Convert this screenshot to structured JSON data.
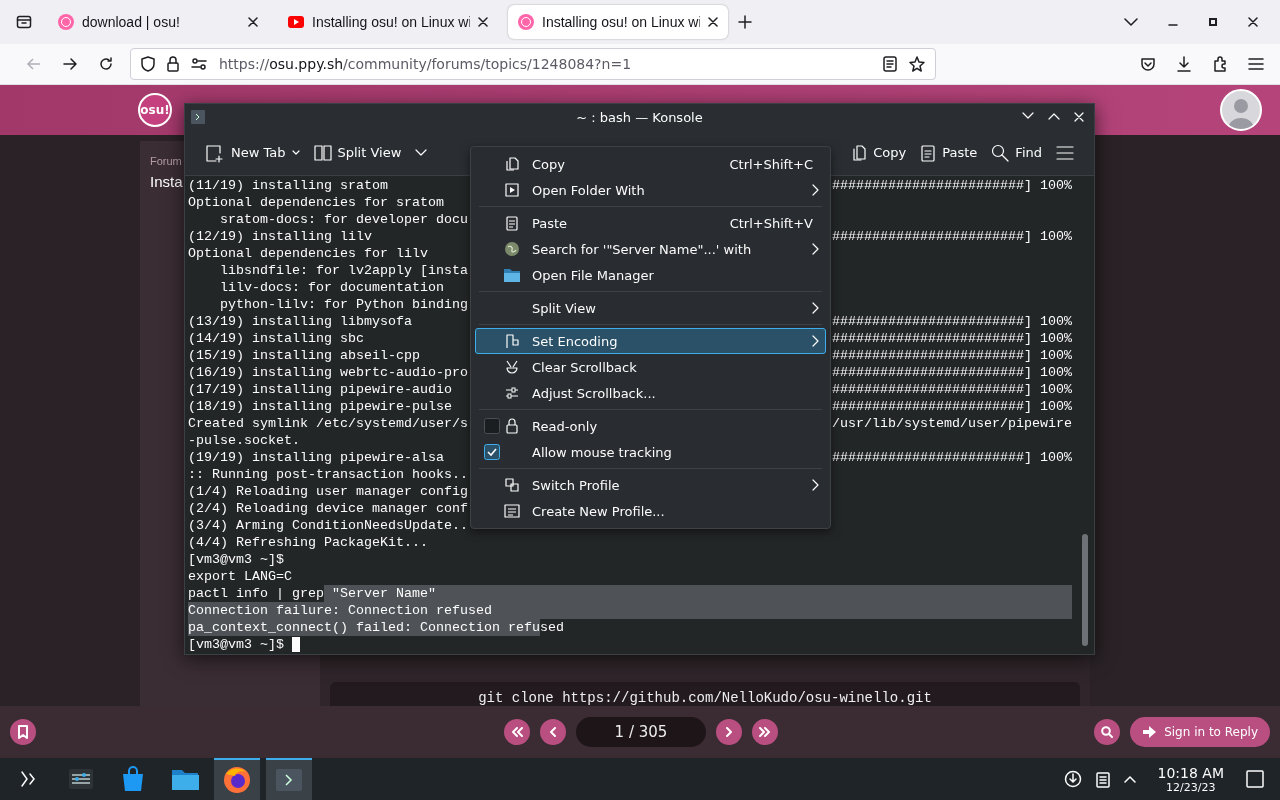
{
  "browser": {
    "tabs": [
      {
        "title": "download | osu!",
        "selected": false
      },
      {
        "title": "Installing osu! on Linux wi",
        "selected": false
      },
      {
        "title": "Installing osu! on Linux wi",
        "selected": true
      }
    ],
    "url": {
      "scheme": "https://",
      "domain": "osu.ppy.sh",
      "path": "/community/forums/topics/1248084?n=1"
    }
  },
  "page": {
    "logo": "osu!",
    "breadcrumb": "Forum",
    "topic_title": "Insta",
    "code": "git clone https://github.com/NelloKudo/osu-winello.git",
    "pagination": "1 / 305",
    "sign_in": "Sign in to Reply"
  },
  "konsole": {
    "title": "~ : bash — Konsole",
    "toolbar_left": [
      "New Tab",
      "Split View"
    ],
    "toolbar_right": [
      "Copy",
      "Paste",
      "Find"
    ],
    "lines": [
      {
        "segments": [
          {
            "text": "(11/19) installing sratom",
            "selected": false
          }
        ],
        "right": "########################] 100%",
        "selected_to_edge": false
      },
      {
        "segments": [
          {
            "text": "Optional dependencies for sratom",
            "selected": false
          }
        ],
        "selected_to_edge": false
      },
      {
        "segments": [
          {
            "text": "    sratom-docs: for developer docu",
            "selected": false
          }
        ],
        "selected_to_edge": false
      },
      {
        "segments": [
          {
            "text": "(12/19) installing lilv",
            "selected": false
          }
        ],
        "right": "########################] 100%",
        "selected_to_edge": false
      },
      {
        "segments": [
          {
            "text": "Optional dependencies for lilv",
            "selected": false
          }
        ],
        "selected_to_edge": false
      },
      {
        "segments": [
          {
            "text": "    libsndfile: for lv2apply [insta",
            "selected": false
          }
        ],
        "selected_to_edge": false
      },
      {
        "segments": [
          {
            "text": "    lilv-docs: for documentation",
            "selected": false
          }
        ],
        "selected_to_edge": false
      },
      {
        "segments": [
          {
            "text": "    python-lilv: for Python binding",
            "selected": false
          }
        ],
        "selected_to_edge": false
      },
      {
        "segments": [
          {
            "text": "(13/19) installing libmysofa",
            "selected": false
          }
        ],
        "right": "########################] 100%",
        "selected_to_edge": false
      },
      {
        "segments": [
          {
            "text": "(14/19) installing sbc",
            "selected": false
          }
        ],
        "right": "########################] 100%",
        "selected_to_edge": false
      },
      {
        "segments": [
          {
            "text": "(15/19) installing abseil-cpp",
            "selected": false
          }
        ],
        "right": "########################] 100%",
        "selected_to_edge": false
      },
      {
        "segments": [
          {
            "text": "(16/19) installing webrtc-audio-pro",
            "selected": false
          }
        ],
        "right": "########################] 100%",
        "selected_to_edge": false
      },
      {
        "segments": [
          {
            "text": "(17/19) installing pipewire-audio",
            "selected": false
          }
        ],
        "right": "########################] 100%",
        "selected_to_edge": false
      },
      {
        "segments": [
          {
            "text": "(18/19) installing pipewire-pulse",
            "selected": false
          }
        ],
        "right": "########################] 100%",
        "selected_to_edge": false
      },
      {
        "segments": [
          {
            "text": "Created symlink /etc/systemd/user/s",
            "selected": false
          }
        ],
        "right": "/usr/lib/systemd/user/pipewire",
        "selected_to_edge": false
      },
      {
        "segments": [
          {
            "text": "-pulse.socket.",
            "selected": false
          }
        ],
        "selected_to_edge": false
      },
      {
        "segments": [
          {
            "text": "(19/19) installing pipewire-alsa",
            "selected": false
          }
        ],
        "right": "########################] 100%",
        "selected_to_edge": false
      },
      {
        "segments": [
          {
            "text": ":: Running post-transaction hooks..",
            "selected": false
          }
        ],
        "selected_to_edge": false
      },
      {
        "segments": [
          {
            "text": "(1/4) Reloading user manager config",
            "selected": false
          }
        ],
        "selected_to_edge": false
      },
      {
        "segments": [
          {
            "text": "(2/4) Reloading device manager conf",
            "selected": false
          }
        ],
        "selected_to_edge": false
      },
      {
        "segments": [
          {
            "text": "(3/4) Arming ConditionNeedsUpdate..",
            "selected": false
          }
        ],
        "selected_to_edge": false
      },
      {
        "segments": [
          {
            "text": "(4/4) Refreshing PackageKit...",
            "selected": false
          }
        ],
        "selected_to_edge": false
      },
      {
        "segments": [
          {
            "text": "[vm3@vm3 ~]$",
            "selected": false
          }
        ],
        "selected_to_edge": false
      },
      {
        "segments": [
          {
            "text": "export LANG=C",
            "selected": false
          }
        ],
        "selected_to_edge": false
      },
      {
        "segments": [
          {
            "text": "pactl info | grep",
            "selected": false
          },
          {
            "text": " \"Server Name\"",
            "selected": true
          }
        ],
        "selected_to_edge": true
      },
      {
        "segments": [
          {
            "text": "Connection failure: Connection refused",
            "selected": true
          }
        ],
        "selected_to_edge": true
      },
      {
        "segments": [
          {
            "text": "pa_context_connect() failed: Connection refu",
            "selected": true
          },
          {
            "text": "sed",
            "selected": false
          }
        ],
        "selected_to_edge": false
      },
      {
        "segments": [
          {
            "text": "[vm3@vm3 ~]$",
            "selected": false
          }
        ],
        "selected_to_edge": false
      }
    ],
    "menu": [
      {
        "kind": "action",
        "label": "Copy",
        "shortcut": "Ctrl+Shift+C",
        "submenu": false,
        "selected": false
      },
      {
        "kind": "action",
        "label": "Open Folder With",
        "submenu": true,
        "selected": false
      },
      {
        "kind": "separator"
      },
      {
        "kind": "action",
        "label": "Paste",
        "shortcut": "Ctrl+Shift+V",
        "submenu": false,
        "selected": false
      },
      {
        "kind": "action",
        "label": "Search for '\"Server Name\"...' with",
        "submenu": true,
        "selected": false
      },
      {
        "kind": "action",
        "label": "Open File Manager",
        "submenu": false,
        "selected": false
      },
      {
        "kind": "separator"
      },
      {
        "kind": "action",
        "label": "Split View",
        "submenu": true,
        "selected": false
      },
      {
        "kind": "separator"
      },
      {
        "kind": "action",
        "label": "Set Encoding",
        "submenu": true,
        "selected": true
      },
      {
        "kind": "action",
        "label": "Clear Scrollback",
        "submenu": false,
        "selected": false
      },
      {
        "kind": "action",
        "label": "Adjust Scrollback...",
        "submenu": false,
        "selected": false
      },
      {
        "kind": "separator"
      },
      {
        "kind": "check",
        "label": "Read-only",
        "checked": false,
        "selected": false
      },
      {
        "kind": "check",
        "label": "Allow mouse tracking",
        "checked": true,
        "selected": false
      },
      {
        "kind": "separator"
      },
      {
        "kind": "action",
        "label": "Switch Profile",
        "submenu": true,
        "selected": false
      },
      {
        "kind": "action",
        "label": "Create New Profile...",
        "submenu": false,
        "selected": false
      }
    ]
  },
  "taskbar": {
    "time": "10:18 AM",
    "date": "12/23/23"
  }
}
